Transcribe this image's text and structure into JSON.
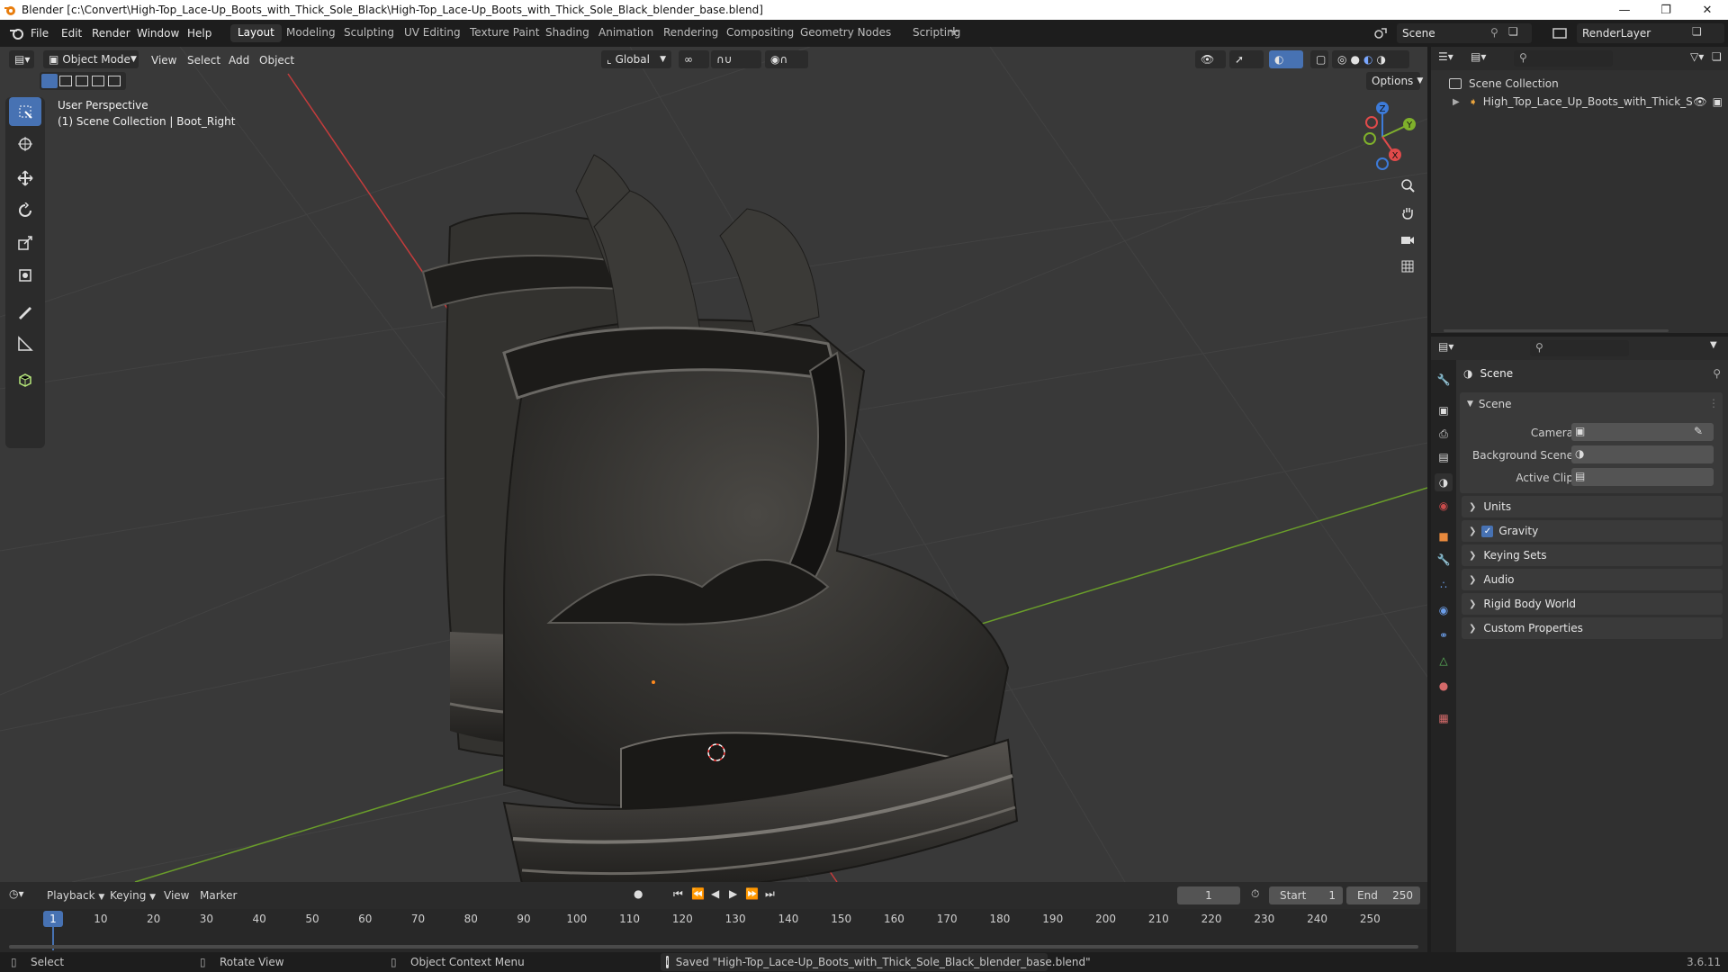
{
  "window": {
    "title": "Blender [c:\\Convert\\High-Top_Lace-Up_Boots_with_Thick_Sole_Black\\High-Top_Lace-Up_Boots_with_Thick_Sole_Black_blender_base.blend]",
    "controls": [
      "minimize-icon",
      "maximize-icon",
      "close-icon"
    ]
  },
  "menu": {
    "items": [
      "File",
      "Edit",
      "Render",
      "Window",
      "Help"
    ],
    "workspaces": [
      "Layout",
      "Modeling",
      "Sculpting",
      "UV Editing",
      "Texture Paint",
      "Shading",
      "Animation",
      "Rendering",
      "Compositing",
      "Geometry Nodes",
      "Scripting"
    ],
    "active_workspace": "Layout",
    "add_workspace": "+",
    "scene": "Scene",
    "view_layer": "RenderLayer"
  },
  "viewport": {
    "mode": "Object Mode",
    "menus": [
      "View",
      "Select",
      "Add",
      "Object"
    ],
    "transform_orientation": "Global",
    "options_label": "Options",
    "overlay_line1": "User Perspective",
    "overlay_line2": "(1) Scene Collection | Boot_Right",
    "gizmo_axes": [
      "X",
      "Y",
      "Z"
    ],
    "tools": [
      "select-box-icon",
      "cursor-icon",
      "move-icon",
      "rotate-icon",
      "scale-icon",
      "transform-icon",
      "annotate-icon",
      "measure-icon",
      "add-cube-icon"
    ],
    "nav_buttons": [
      "zoom-icon",
      "pan-hand-icon",
      "camera-view-icon",
      "ortho-grid-icon"
    ],
    "colors": {
      "background": "#393939",
      "x_axis": "#c43c3c",
      "y_axis": "#6a9e2a"
    }
  },
  "outliner": {
    "root": "Scene Collection",
    "items": [
      {
        "label": "High_Top_Lace_Up_Boots_with_Thick_S"
      }
    ]
  },
  "properties": {
    "context_title": "Scene",
    "panel_title": "Scene",
    "fields": [
      {
        "label": "Camera",
        "value": ""
      },
      {
        "label": "Background Scene",
        "value": ""
      },
      {
        "label": "Active Clip",
        "value": ""
      }
    ],
    "subpanels": [
      "Units",
      "Gravity",
      "Keying Sets",
      "Audio",
      "Rigid Body World",
      "Custom Properties"
    ],
    "gravity_enabled": true
  },
  "timeline": {
    "menus": [
      "Playback",
      "Keying",
      "View",
      "Marker"
    ],
    "current_frame": "1",
    "start_label": "Start",
    "start": "1",
    "end_label": "End",
    "end": "250",
    "ticks": [
      "1",
      "10",
      "20",
      "30",
      "40",
      "50",
      "60",
      "70",
      "80",
      "90",
      "100",
      "110",
      "120",
      "130",
      "140",
      "150",
      "160",
      "170",
      "180",
      "190",
      "200",
      "210",
      "220",
      "230",
      "240",
      "250"
    ]
  },
  "status": {
    "select": "Select",
    "rotate": "Rotate View",
    "context": "Object Context Menu",
    "message": "Saved \"High-Top_Lace-Up_Boots_with_Thick_Sole_Black_blender_base.blend\"",
    "version": "3.6.11"
  }
}
